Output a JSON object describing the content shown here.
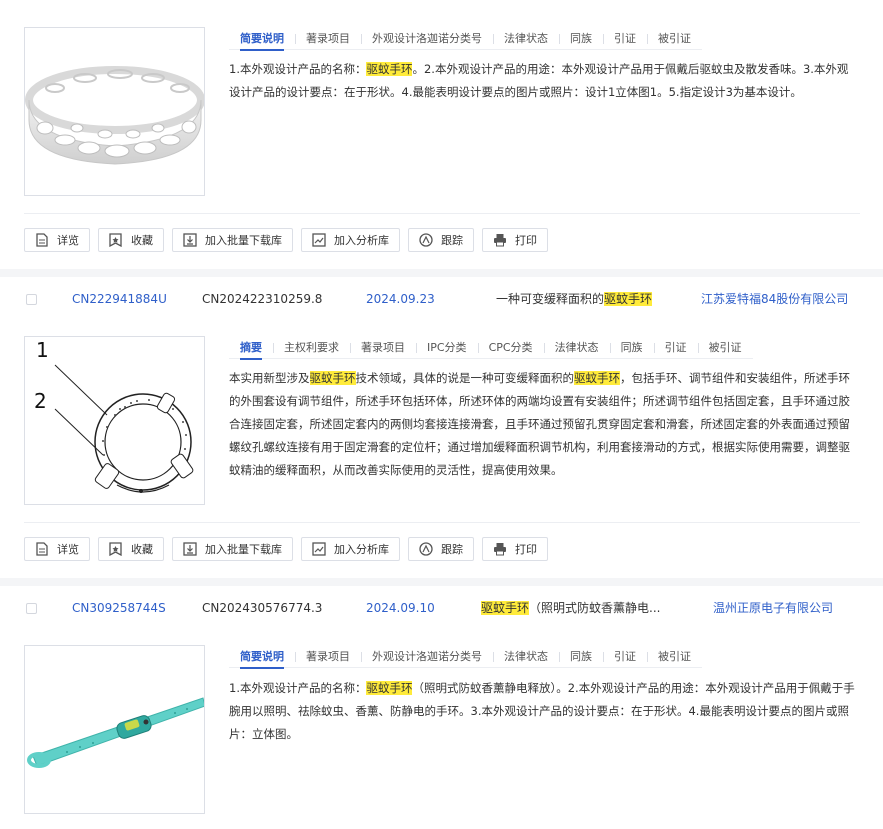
{
  "colors": {
    "accent": "#2f5fc9",
    "highlight": "#ffeb3b",
    "border": "#dcdfe6"
  },
  "actions": {
    "detail": "详览",
    "favorite": "收藏",
    "batch_download": "加入批量下载库",
    "analysis": "加入分析库",
    "track": "跟踪",
    "print": "打印"
  },
  "card1": {
    "tabs": [
      "简要说明",
      "著录项目",
      "外观设计洛迦诺分类号",
      "法律状态",
      "同族",
      "引证",
      "被引证"
    ],
    "desc": {
      "p1": "1.本外观设计产品的名称：",
      "hl1": "驱蚊手环",
      "p2": "。2.本外观设计产品的用途：本外观设计产品用于佩戴后驱蚊虫及散发香味。3.本外观设计产品的设计要点：在于形状。4.最能表明设计要点的图片或照片：设计1立体图1。5.指定设计3为基本设计。"
    }
  },
  "card2": {
    "pub_no": "CN222941884U",
    "app_no": "CN202422310259.8",
    "date": "2024.09.23",
    "title_prefix": "一种可变缓释面积的",
    "title_hl": "驱蚊手环",
    "applicant": "江苏爱特福84股份有限公司",
    "fig_label_1": "1",
    "fig_label_2": "2",
    "tabs": [
      "摘要",
      "主权利要求",
      "著录项目",
      "IPC分类",
      "CPC分类",
      "法律状态",
      "同族",
      "引证",
      "被引证"
    ],
    "desc": {
      "p1": "本实用新型涉及",
      "hl1": "驱蚊手环",
      "p2": "技术领域，具体的说是一种可变缓释面积的",
      "hl2": "驱蚊手环",
      "p3": "，包括手环、调节组件和安装组件，所述手环的外围套设有调节组件，所述手环包括环体，所述环体的两端均设置有安装组件；所述调节组件包括固定套，且手环通过胶合连接固定套，所述固定套内的两侧均套接连接滑套，且手环通过预留孔贯穿固定套和滑套，所述固定套的外表面通过预留螺纹孔螺纹连接有用于固定滑套的定位杆；通过增加缓释面积调节机构，利用套接滑动的方式，根据实际使用需要，调整驱蚊精油的缓释面积，从而改善实际使用的灵活性，提高使用效果。"
    }
  },
  "card3": {
    "pub_no": "CN309258744S",
    "app_no": "CN202430576774.3",
    "date": "2024.09.10",
    "title_hl": "驱蚊手环",
    "title_rest": "（照明式防蚊香薰静电...",
    "applicant": "温州正原电子有限公司",
    "tabs": [
      "简要说明",
      "著录项目",
      "外观设计洛迦诺分类号",
      "法律状态",
      "同族",
      "引证",
      "被引证"
    ],
    "desc": {
      "p1": "1.本外观设计产品的名称：",
      "hl1": "驱蚊手环",
      "p2": "（照明式防蚊香薰静电释放）。2.本外观设计产品的用途：本外观设计产品用于佩戴于手腕用以照明、祛除蚊虫、香薰、防静电的手环。3.本外观设计产品的设计要点：在于形状。4.最能表明设计要点的图片或照片：立体图。"
    }
  }
}
